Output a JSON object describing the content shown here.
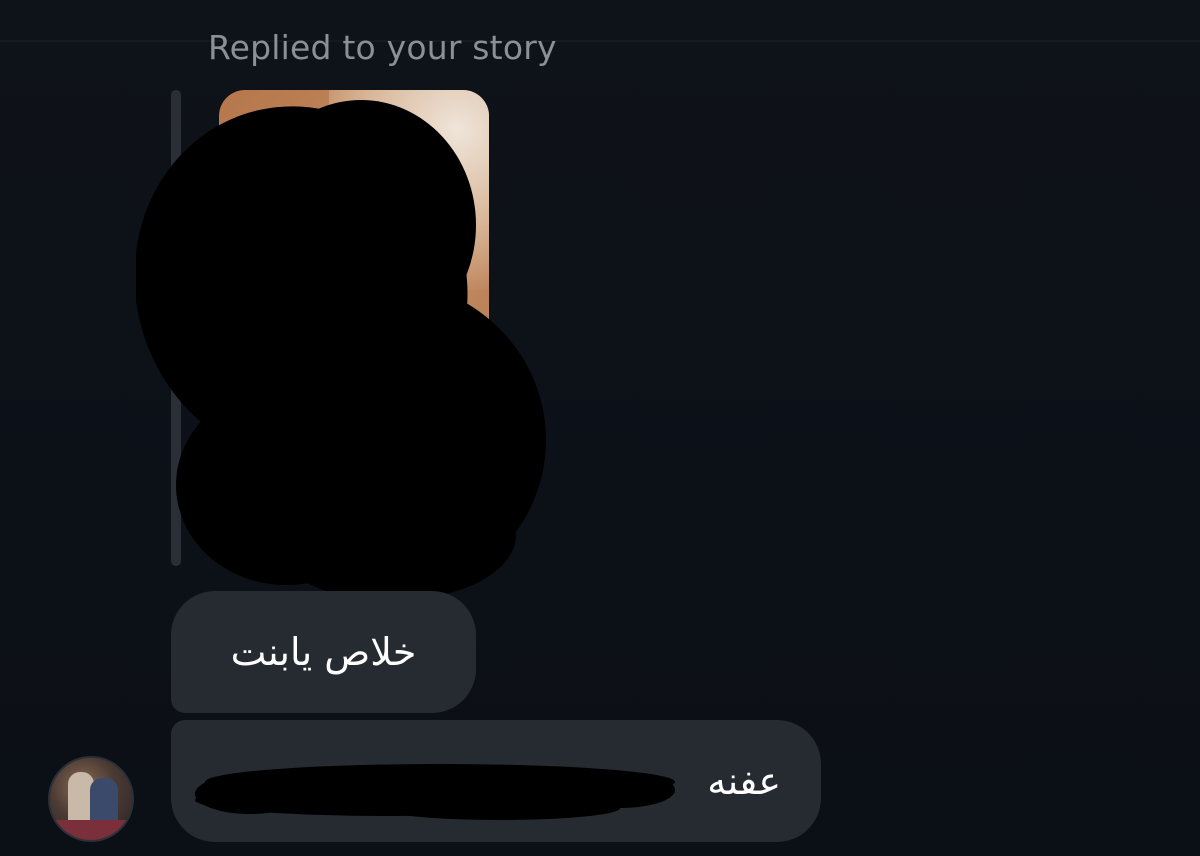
{
  "thread": {
    "replied_label": "Replied to your story",
    "story_preview": {
      "icon": "story-thumbnail",
      "redacted": true
    },
    "messages": [
      {
        "text": "خلاص يابنت",
        "direction": "rtl"
      },
      {
        "text": "عفنه",
        "direction": "rtl",
        "partially_redacted": true
      }
    ],
    "sender_avatar": {
      "icon": "avatar"
    }
  },
  "colors": {
    "background": "#0c1017",
    "bubble": "#262a31",
    "label": "#8b9098",
    "reply_bar": "#2a2f37",
    "text": "#ffffff"
  }
}
